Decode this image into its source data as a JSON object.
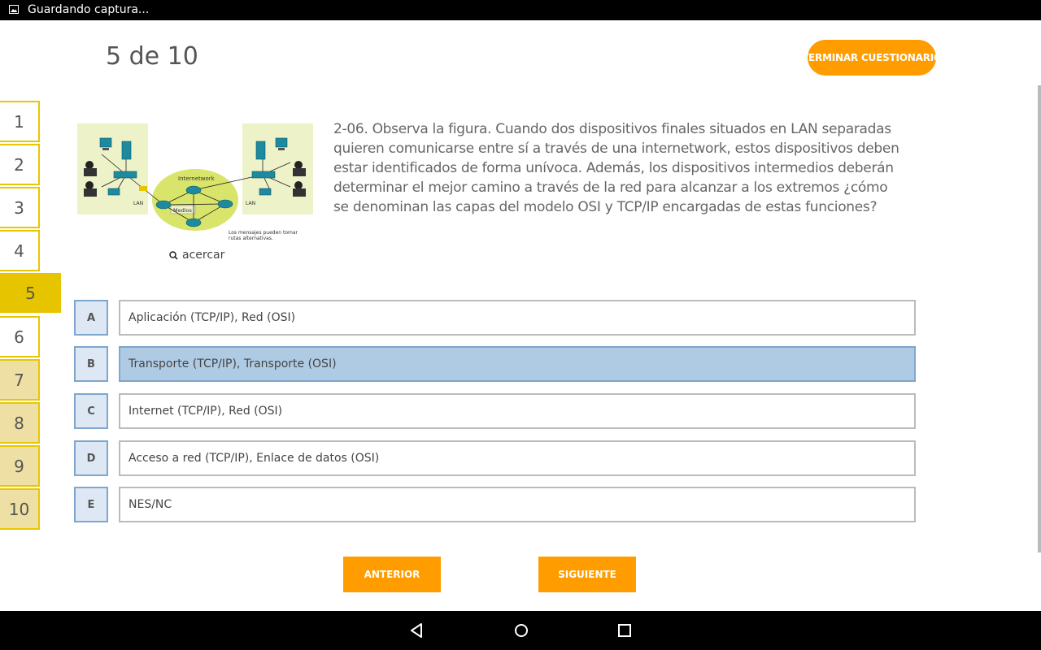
{
  "statusbar": {
    "notification": "Guardando captura...",
    "icon": "image-icon"
  },
  "header": {
    "counter": "5 de 10",
    "finish_label": "TERMINAR CUESTIONARIO"
  },
  "question_nav": [
    {
      "n": "1",
      "state": "answered"
    },
    {
      "n": "2",
      "state": "answered"
    },
    {
      "n": "3",
      "state": "answered"
    },
    {
      "n": "4",
      "state": "answered"
    },
    {
      "n": "5",
      "state": "current"
    },
    {
      "n": "6",
      "state": "answered"
    },
    {
      "n": "7",
      "state": "pending"
    },
    {
      "n": "8",
      "state": "pending"
    },
    {
      "n": "9",
      "state": "pending"
    },
    {
      "n": "10",
      "state": "pending"
    }
  ],
  "figure": {
    "internetwork_label": "Internetwork",
    "lan_left": "LAN",
    "lan_right": "LAN",
    "media_label": "Medios",
    "caption": "Los mensajes pueden tomar rutas alternativas.",
    "zoom_label": "acercar"
  },
  "question": {
    "text": "2-06. Observa la figura. Cuando dos dispositivos finales situados en LAN separadas quieren comunicarse entre sí a través de una internetwork, estos dispositivos deben estar identificados de forma unívoca. Además, los dispositivos intermedios deberán determinar el mejor camino a través de la red para alcanzar a los extremos ¿cómo se denominan las capas del modelo OSI y TCP/IP encargadas de estas funciones?"
  },
  "options": [
    {
      "letter": "A",
      "text": "Aplicación (TCP/IP), Red (OSI)",
      "selected": false
    },
    {
      "letter": "B",
      "text": "Transporte (TCP/IP), Transporte (OSI)",
      "selected": true
    },
    {
      "letter": "C",
      "text": "Internet (TCP/IP), Red (OSI)",
      "selected": false
    },
    {
      "letter": "D",
      "text": "Acceso a red (TCP/IP), Enlace de datos (OSI)",
      "selected": false
    },
    {
      "letter": "E",
      "text": "NES/NC",
      "selected": false
    }
  ],
  "footer": {
    "prev_label": "ANTERIOR",
    "next_label": "SIGUIENTE"
  },
  "colors": {
    "accent": "#FF9C00",
    "nav_border": "#E8C600",
    "selected_option": "#AFCBE4"
  }
}
